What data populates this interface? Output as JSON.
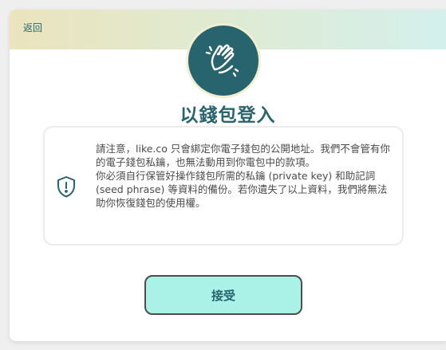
{
  "header": {
    "back_label": "返回"
  },
  "title": "以錢包登入",
  "notice": {
    "paragraph1": "請注意，like.co 只會綁定你電子錢包的公開地址。我們不會管有你的電子錢包私鑰，也無法動用到你電包中的款項。",
    "paragraph2": "你必須自行保管好操作錢包所需的私鑰 (private key) 和助記詞 (seed phrase) 等資料的備份。若你遺失了以上資料，我們將無法助你恢復錢包的使用權。"
  },
  "actions": {
    "accept_label": "接受"
  },
  "icons": {
    "avatar": "clapping-hands-icon",
    "notice": "shield-icon"
  },
  "colors": {
    "brand": "#28646e",
    "accept_bg": "#aaf1e7"
  }
}
